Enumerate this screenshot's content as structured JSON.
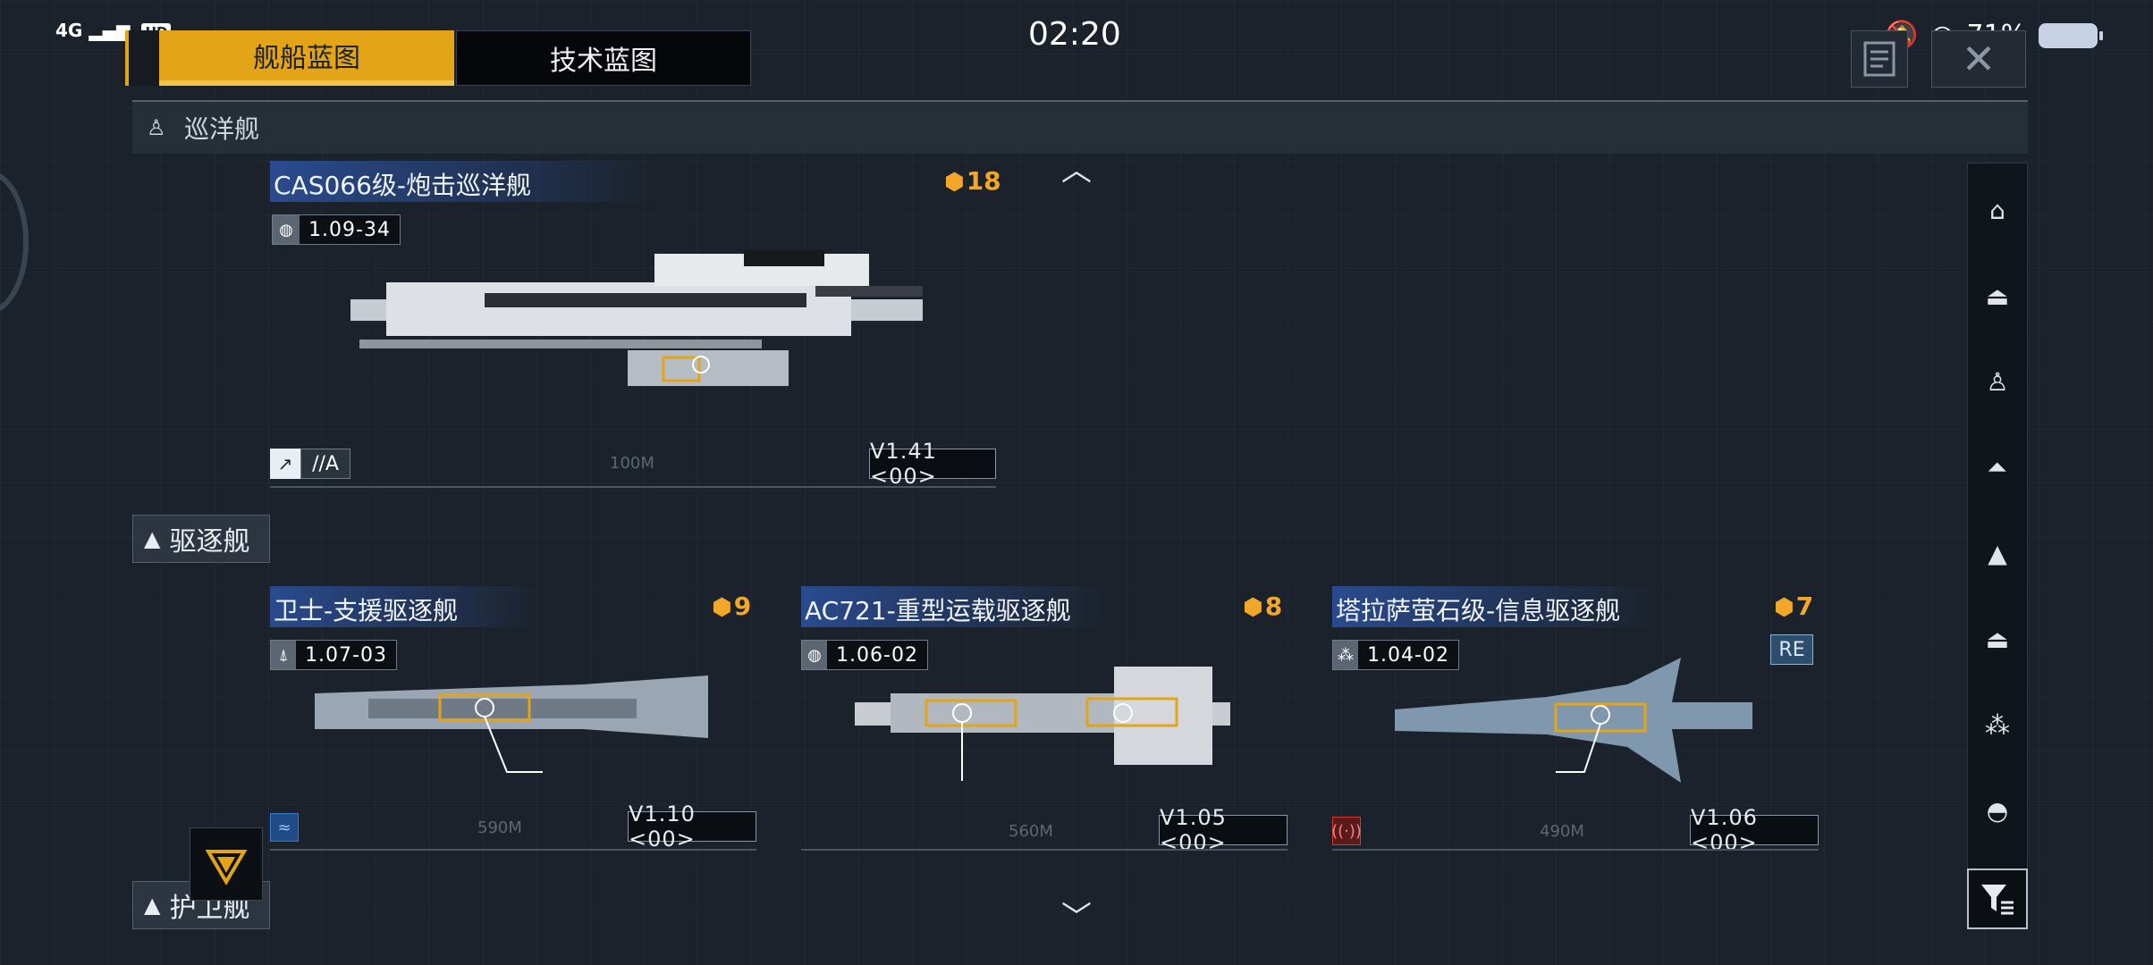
{
  "status_bar": {
    "network": "4G",
    "hd": "HD",
    "time": "02:20",
    "battery": "71%"
  },
  "tabs": [
    {
      "label": "舰船蓝图",
      "active": true
    },
    {
      "label": "技术蓝图",
      "active": false
    }
  ],
  "sections": {
    "cruiser": "巡洋舰",
    "destroyer": "驱逐舰",
    "frigate": "护卫舰"
  },
  "ships": [
    {
      "name": "CAS066级-炮击巡洋舰",
      "cost": "18",
      "version": "1.09",
      "sub_version": "34",
      "variant": "//A",
      "blueprint_version": "V1.41 <00>",
      "length": "100M",
      "version_icon": "globe-icon"
    },
    {
      "name": "卫士-支援驱逐舰",
      "cost": "9",
      "version": "1.07",
      "sub_version": "03",
      "blueprint_version": "V1.10 <00>",
      "length": "590M",
      "version_icon": "faction-icon"
    },
    {
      "name": "AC721-重型运载驱逐舰",
      "cost": "8",
      "version": "1.06",
      "sub_version": "02",
      "blueprint_version": "V1.05 <00>",
      "length": "560M",
      "version_icon": "globe-icon"
    },
    {
      "name": "塔拉萨萤石级-信息驱逐舰",
      "cost": "7",
      "version": "1.04",
      "sub_version": "02",
      "badge": "RE",
      "blueprint_version": "V1.06 <00>",
      "length": "490M",
      "version_icon": "tri-faction-icon"
    }
  ],
  "colors": {
    "accent": "#e3a417",
    "cost": "#f2a72b",
    "title_band": "#2c52a0",
    "support_role": "#3a78c8",
    "info_role": "#d23a3a"
  }
}
